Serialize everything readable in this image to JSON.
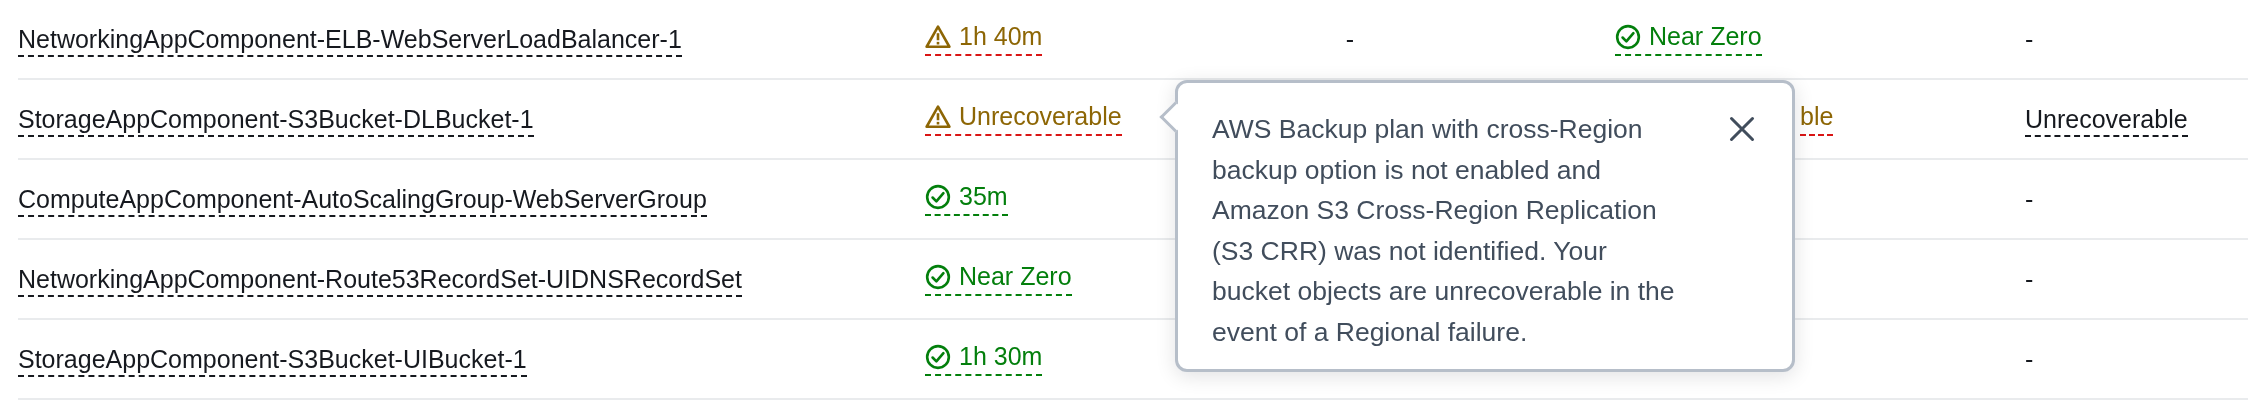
{
  "rows": [
    {
      "name": "NetworkingAppComponent-ELB-WebServerLoadBalancer-1",
      "cells": [
        {
          "kind": "status",
          "warning": true,
          "text": "1h 40m"
        },
        {
          "kind": "plain",
          "text": "-"
        },
        {
          "kind": "status",
          "warning": false,
          "text": "Near Zero"
        },
        {
          "kind": "plain",
          "text": "-"
        }
      ]
    },
    {
      "name": "StorageAppComponent-S3Bucket-DLBucket-1",
      "cells": [
        {
          "kind": "status",
          "warning": true,
          "text": "Unrecoverable"
        },
        {
          "kind": "hidden"
        },
        {
          "kind": "clipped",
          "warning": true,
          "text": "ble"
        },
        {
          "kind": "link",
          "text": "Unrecoverable"
        }
      ]
    },
    {
      "name": "ComputeAppComponent-AutoScalingGroup-WebServerGroup",
      "cells": [
        {
          "kind": "status",
          "warning": false,
          "text": "35m"
        },
        {
          "kind": "hidden"
        },
        {
          "kind": "hidden"
        },
        {
          "kind": "plain",
          "text": "-"
        }
      ]
    },
    {
      "name": "NetworkingAppComponent-Route53RecordSet-UIDNSRecordSet",
      "cells": [
        {
          "kind": "status",
          "warning": false,
          "text": "Near Zero"
        },
        {
          "kind": "hidden"
        },
        {
          "kind": "hidden"
        },
        {
          "kind": "plain",
          "text": "-"
        }
      ]
    },
    {
      "name": "StorageAppComponent-S3Bucket-UIBucket-1",
      "cells": [
        {
          "kind": "status",
          "warning": false,
          "text": "1h 30m"
        },
        {
          "kind": "hidden"
        },
        {
          "kind": "hidden"
        },
        {
          "kind": "plain",
          "text": "-"
        }
      ]
    }
  ],
  "popover": {
    "text": "AWS Backup plan with cross-Region backup option is not enabled and Amazon S3 Cross-Region Replication (S3 CRR) was not identified. Your bucket objects are unrecoverable in the event of a Regional failure.",
    "closable": true
  }
}
